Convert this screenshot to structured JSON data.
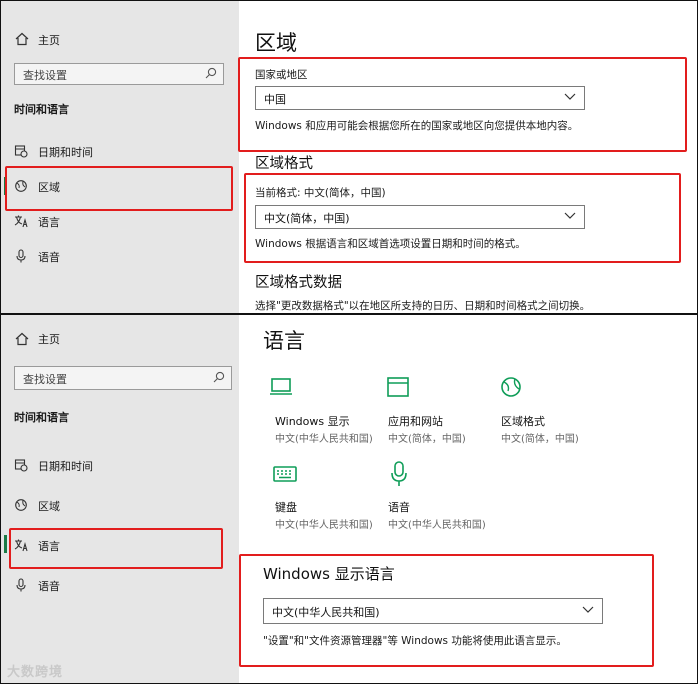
{
  "top": {
    "sidebar": {
      "home": "主页",
      "search_placeholder": "查找设置",
      "section_title": "时间和语言",
      "items": [
        "日期和时间",
        "区域",
        "语言",
        "语音"
      ],
      "active_index": 1
    },
    "main": {
      "title": "区域",
      "country_label": "国家或地区",
      "country_value": "中国",
      "country_desc": "Windows 和应用可能会根据您所在的国家或地区向您提供本地内容。",
      "format_title": "区域格式",
      "current_format": "当前格式: 中文(简体，中国)",
      "format_value": "中文(简体，中国)",
      "format_desc": "Windows 根据语言和区域首选项设置日期和时间的格式。",
      "format_data_title": "区域格式数据",
      "format_data_desc": "选择\"更改数据格式\"以在地区所支持的日历、日期和时间格式之间切换。"
    }
  },
  "bottom": {
    "sidebar": {
      "home": "主页",
      "search_placeholder": "查找设置",
      "section_title": "时间和语言",
      "items": [
        "日期和时间",
        "区域",
        "语言",
        "语音"
      ],
      "active_index": 2
    },
    "main": {
      "title": "语言",
      "tiles": [
        {
          "label": "Windows 显示",
          "sub": "中文(中华人民共和国)",
          "icon": "monitor-icon"
        },
        {
          "label": "应用和网站",
          "sub": "中文(简体，中国)",
          "icon": "browser-window-icon"
        },
        {
          "label": "区域格式",
          "sub": "中文(简体，中国)",
          "icon": "globe-icon"
        },
        {
          "label": "键盘",
          "sub": "中文(中华人民共和国)",
          "icon": "keyboard-icon"
        },
        {
          "label": "语音",
          "sub": "中文(中华人民共和国)",
          "icon": "microphone-icon"
        }
      ],
      "display_lang_title": "Windows 显示语言",
      "display_lang_value": "中文(中华人民共和国)",
      "display_lang_desc": "\"设置\"和\"文件资源管理器\"等 Windows 功能将使用此语言显示。"
    },
    "watermark": "大数跨境"
  },
  "colors": {
    "accent": "#0f9d58",
    "highlight": "#e21d1d",
    "sidebar_bg": "#e6e6e6"
  }
}
